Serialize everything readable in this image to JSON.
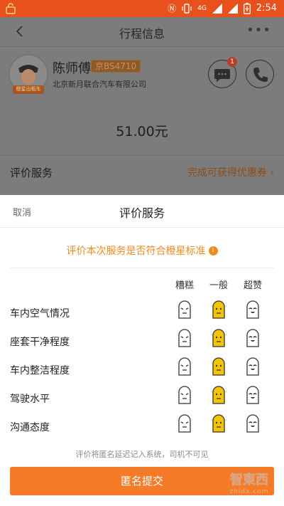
{
  "status_bar": {
    "time": "2:54",
    "network": "4G"
  },
  "nav": {
    "title": "行程信息"
  },
  "driver": {
    "name": "陈师傅",
    "plate": "京BS4710",
    "company": "北京新月联合汽车有限公司",
    "avatar_badge": "橙星出租车",
    "unread_count": "1"
  },
  "trip": {
    "fare": "51.00元"
  },
  "rating_entry": {
    "label": "评价服务",
    "promo": "完成可获得优惠券 ›"
  },
  "sheet": {
    "cancel": "取消",
    "title": "评价服务",
    "question": "评价本次服务是否符合橙星标准",
    "columns": [
      "糟糕",
      "一般",
      "超赞"
    ],
    "rows": [
      {
        "label": "车内空气情况",
        "selected": "一般"
      },
      {
        "label": "座套干净程度",
        "selected": "一般"
      },
      {
        "label": "车内整洁程度",
        "selected": "一般"
      },
      {
        "label": "驾驶水平",
        "selected": "一般"
      },
      {
        "label": "沟通态度",
        "selected": "一般"
      }
    ],
    "note": "评价将匿名延迟记入系统，司机不可见",
    "submit": "匿名提交"
  },
  "watermark": {
    "text": "智東西",
    "sub": "zhidx.com"
  },
  "colors": {
    "accent": "#f57b28",
    "status_bar": "#e8511c",
    "question": "#f08a1c",
    "selected_face": "#f2c500"
  }
}
